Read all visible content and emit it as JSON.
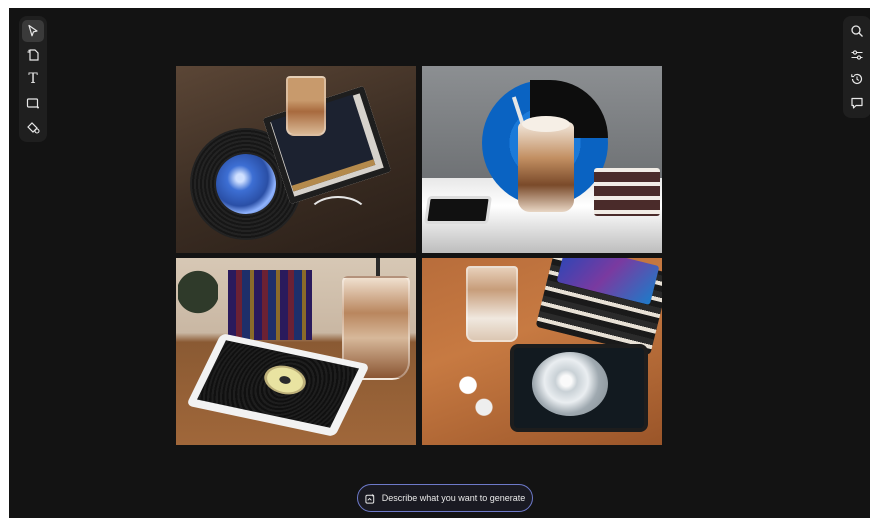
{
  "left_toolbar": {
    "tools": [
      {
        "name": "select",
        "icon": "pointer-arrow-icon",
        "active": true
      },
      {
        "name": "generate-image",
        "icon": "image-gen-icon",
        "active": false
      },
      {
        "name": "text",
        "icon": "text-tool-icon",
        "glyph": "T",
        "active": false
      },
      {
        "name": "shape",
        "icon": "rectangle-icon",
        "active": false
      },
      {
        "name": "fill",
        "icon": "paint-bucket-icon",
        "active": false
      }
    ]
  },
  "right_toolbar": {
    "tools": [
      {
        "name": "search",
        "icon": "search-icon"
      },
      {
        "name": "adjustments",
        "icon": "sliders-icon"
      },
      {
        "name": "history",
        "icon": "history-icon"
      },
      {
        "name": "comments",
        "icon": "comment-icon"
      }
    ]
  },
  "prompt_bar": {
    "label": "Describe what you want to generate",
    "icon": "generate-icon",
    "accent": "#6d79c9"
  },
  "canvas": {
    "background": "#131313",
    "images": [
      {
        "index": 1,
        "description_icon": "image"
      },
      {
        "index": 2,
        "description_icon": "image"
      },
      {
        "index": 3,
        "description_icon": "image"
      },
      {
        "index": 4,
        "description_icon": "image"
      }
    ]
  }
}
